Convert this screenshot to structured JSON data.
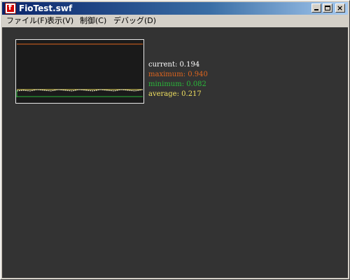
{
  "window": {
    "title": "FioTest.swf",
    "close_glyph": "×"
  },
  "menu": [
    {
      "label": "ファイル(F)"
    },
    {
      "label": "表示(V)"
    },
    {
      "label": "制御(C)"
    },
    {
      "label": "デバッグ(D)"
    }
  ],
  "stats": {
    "current": {
      "label": "current:",
      "value": "0.194",
      "color": "#ffffff"
    },
    "maximum": {
      "label": "maximum:",
      "value": "0.940",
      "color": "#e0651e"
    },
    "minimum": {
      "label": "minimum:",
      "value": "0.082",
      "color": "#2ab83a"
    },
    "average": {
      "label": "average:",
      "value": "0.217",
      "color": "#f0e060"
    }
  },
  "colors": {
    "stage": "#333333",
    "graph_bg": "#1a1a1a"
  }
}
